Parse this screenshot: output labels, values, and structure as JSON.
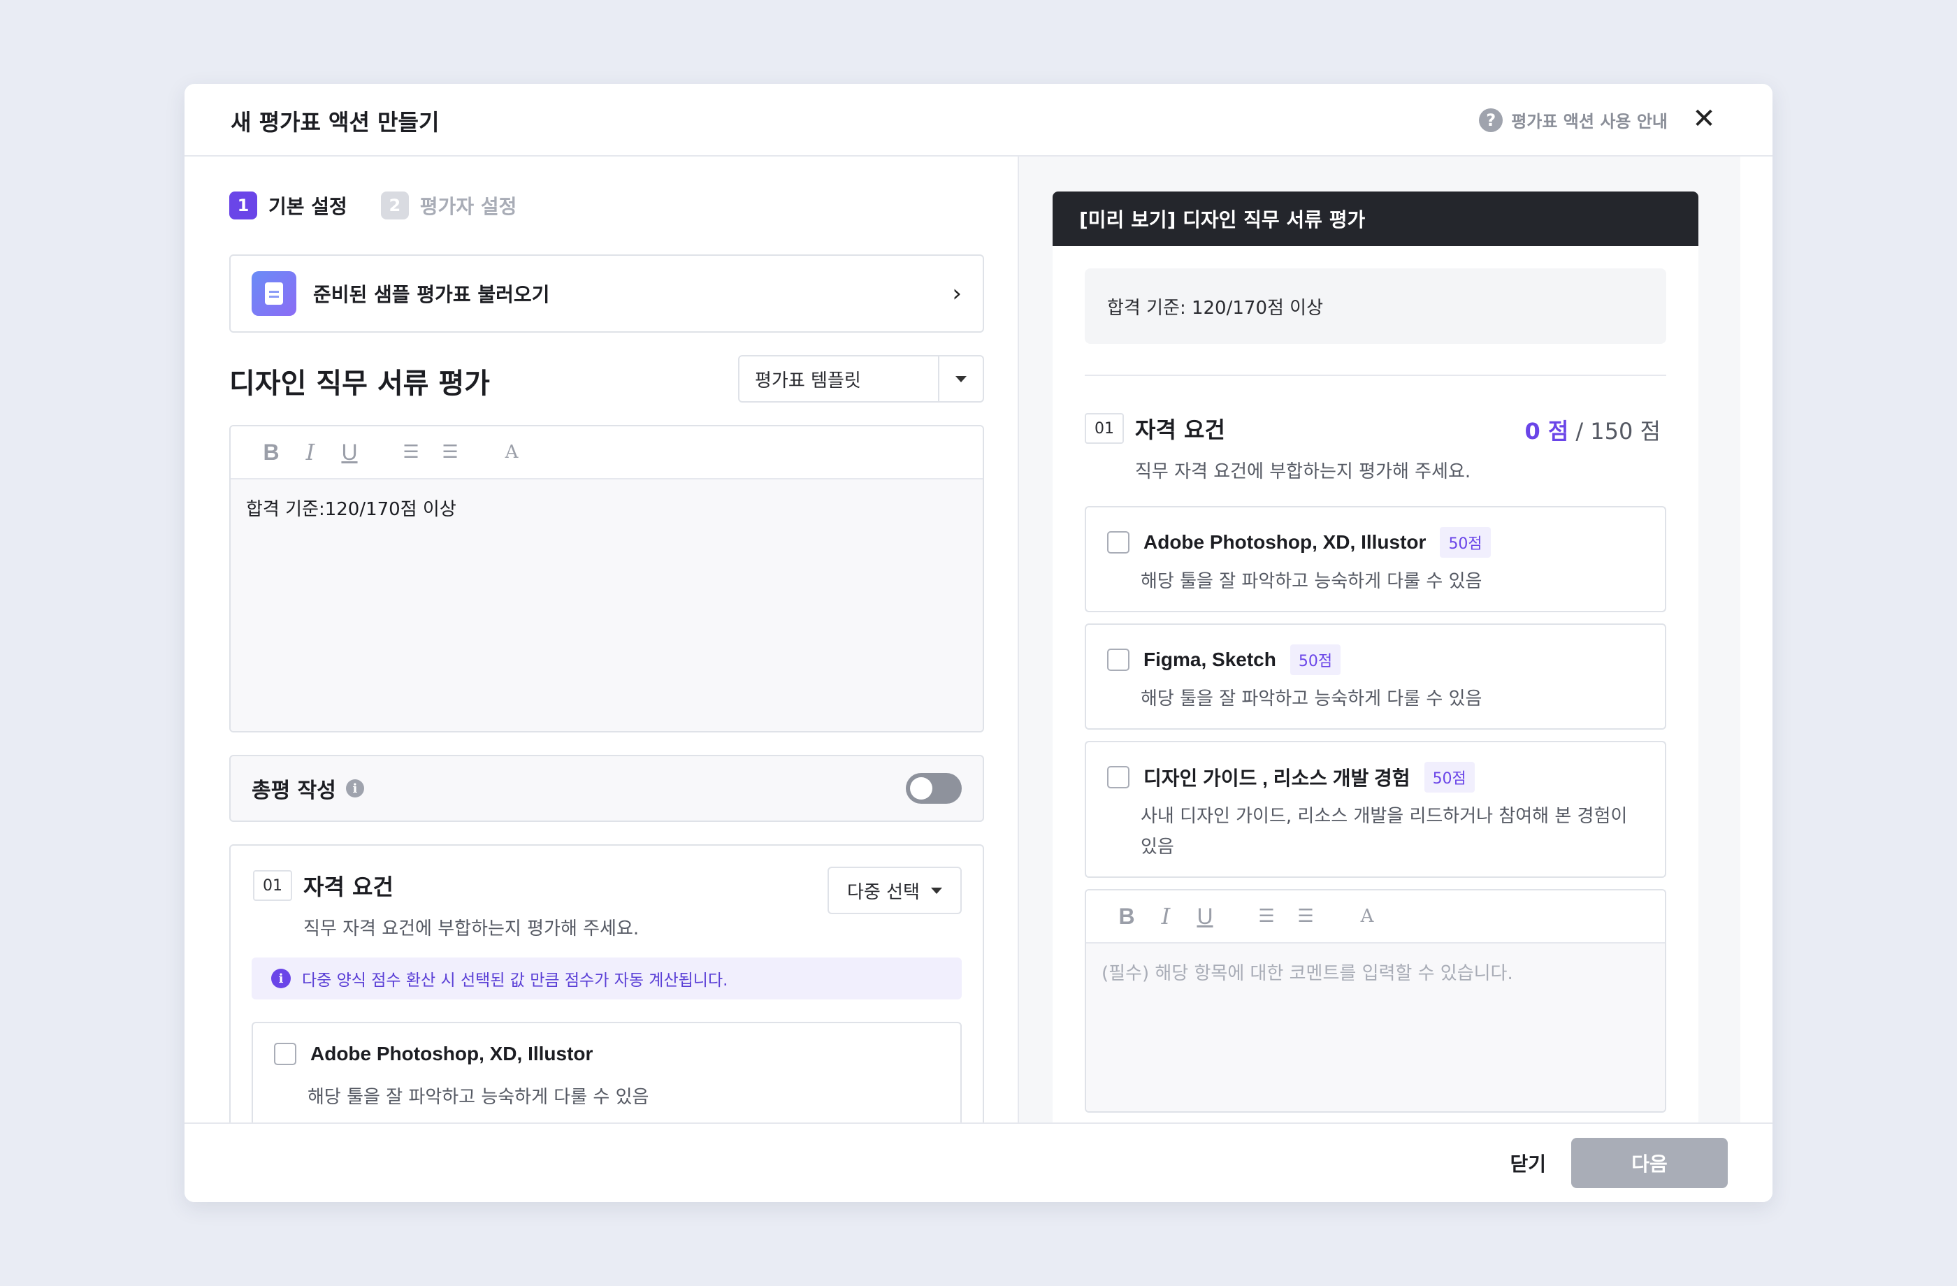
{
  "modal": {
    "title": "새 평가표 액션 만들기",
    "help_label": "평가표 액션 사용 안내",
    "help_icon": "?",
    "close_icon": "✕"
  },
  "steps": [
    {
      "num": "1",
      "label": "기본 설정"
    },
    {
      "num": "2",
      "label": "평가자 설정"
    }
  ],
  "sample": {
    "label": "준비된 샘플 평가표 불러오기",
    "chevron": "›"
  },
  "form": {
    "title": "디자인 직무 서류 평가",
    "template_value": "평가표 템플릿",
    "editor_text": "합격 기준:120/170점 이상"
  },
  "toolbar": {
    "bold": "B",
    "italic": "I",
    "underline": "U",
    "ordered": "☰",
    "bullet": "☰",
    "color": "A"
  },
  "summary": {
    "label": "총평 작성",
    "info_icon": "i",
    "toggle_on": false
  },
  "section": {
    "num": "01",
    "name": "자격 요건",
    "desc": "직무 자격 요건에 부합하는지 평가해 주세요.",
    "select_value": "다중 선택",
    "notice": "다중 양식 점수 환산 시 선택된 값 만큼 점수가 자동 계산됩니다.",
    "notice_icon": "i",
    "item": {
      "name": "Adobe Photoshop, XD, Illustor",
      "desc": "해당 툴을 잘 파악하고 능숙하게 다룰 수 있음"
    }
  },
  "footer": {
    "close_label": "닫기",
    "next_label": "다음"
  },
  "preview": {
    "header": "[미리 보기] 디자인 직무 서류 평가",
    "pass_text": "합격 기준: 120/170점 이상",
    "section_num": "01",
    "section_name": "자격 요건",
    "score_current": "0 점",
    "score_max": "/ 150 점",
    "section_desc": "직무 자격 요건에 부합하는지 평가해 주세요.",
    "items": [
      {
        "name": "Adobe Photoshop, XD, Illustor",
        "points": "50점",
        "desc": "해당 툴을 잘 파악하고 능숙하게 다룰 수 있음"
      },
      {
        "name": "Figma, Sketch",
        "points": "50점",
        "desc": "해당 툴을 잘 파악하고 능숙하게 다룰 수 있음"
      },
      {
        "name": "디자인 가이드 , 리소스 개발 경험",
        "points": "50점",
        "desc": "사내 디자인 가이드, 리소스 개발을 리드하거나 참여해 본 경험이 있음"
      }
    ],
    "comment_placeholder": "(필수) 해당 항목에 대한 코멘트를 입력할 수 있습니다."
  },
  "colors": {
    "accent": "#6a45e8",
    "header_dark": "#24262c",
    "disabled": "#a9adb7"
  }
}
